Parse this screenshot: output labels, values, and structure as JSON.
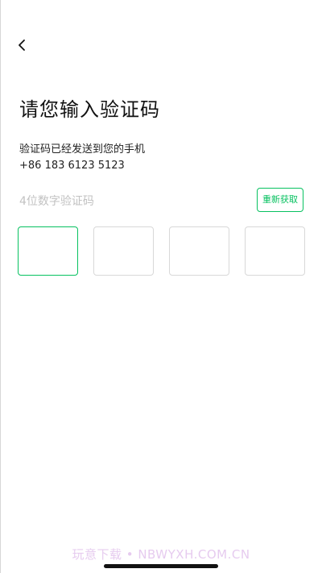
{
  "header": {
    "back_icon": "chevron-left-icon"
  },
  "page": {
    "title": "请您输入验证码",
    "subtitle_line1": "验证码已经发送到您的手机",
    "phone_number": "+86 183 6123 5123"
  },
  "code_input": {
    "hint": "4位数字验证码",
    "resend_label": "重新获取",
    "digits": [
      "",
      "",
      "",
      ""
    ],
    "active_index": 0
  },
  "watermark": {
    "text": "玩意下载 • NBWYXH.COM.CN"
  },
  "colors": {
    "accent": "#07c160",
    "box_border": "#d8d8d8",
    "hint_text": "#c2c2c2"
  }
}
